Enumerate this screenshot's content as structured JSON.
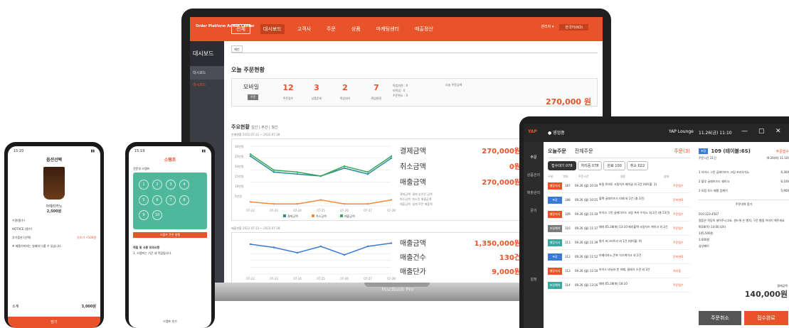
{
  "laptop": {
    "brand": "MacBook Pro",
    "logo": "Order Platform\nAdmin Center",
    "nav": [
      "전체",
      "대시보드",
      "고객사",
      "주문",
      "상품",
      "마케팅센터",
      "매출정산"
    ],
    "user": "관리자 ▾",
    "lang": "한국어(KO)",
    "side": {
      "title": "대시보드",
      "items": [
        "대시보드"
      ],
      "sub": "대시보드"
    },
    "tab": "메인",
    "today": {
      "title": "오늘 주문현황",
      "name": "모바일",
      "badge": "주문",
      "kpis": [
        {
          "v": "12",
          "l": "주문접수"
        },
        {
          "v": "3",
          "l": "상품준비"
        },
        {
          "v": "2",
          "l": "픽업대기"
        },
        {
          "v": "7",
          "l": "픽업완료"
        }
      ],
      "mini": [
        "픽업지연 : 0",
        "미픽업 : 0",
        "주문취소 : 0"
      ],
      "total_label": "오늘 주문금액",
      "total": "270,000 원"
    },
    "trend": {
      "title": "주요현황",
      "periods": "일간 | 주간 | 월간",
      "sub1": "판매현황 2022-07-22 ~ 2022-07-28",
      "rows": [
        {
          "l": "결제금액",
          "v": "270,000원"
        },
        {
          "l": "취소금액",
          "v": "0원"
        },
        {
          "l": "매출금액",
          "v": "270,000원"
        }
      ],
      "notes": [
        "결제금액: 결제 승인된 금액",
        "취소금액: 취소된 매출금액",
        "매출금액: 실제 주문 매출액"
      ],
      "legend": [
        "결제금액",
        "취소금액",
        "매출금액"
      ],
      "sub2": "매출현황 2022-07-22 ~ 2022-07-28",
      "rows2": [
        {
          "l": "매출금액",
          "v": "1,350,000원"
        },
        {
          "l": "매출건수",
          "v": "130건"
        },
        {
          "l": "매출단가",
          "v": "9,000원"
        }
      ]
    }
  },
  "chart_data": [
    {
      "type": "line",
      "title": "판매현황",
      "categories": [
        "07-22",
        "07-23",
        "07-24",
        "07-25",
        "07-26",
        "07-27",
        "07-28"
      ],
      "ylabels": [
        "5만원",
        "10만원",
        "15만원",
        "20만원",
        "25만원",
        "30만원"
      ],
      "series": [
        {
          "name": "결제금액",
          "values": [
            25,
            17,
            16,
            15,
            19,
            16,
            24
          ]
        },
        {
          "name": "취소금액",
          "values": [
            2,
            1,
            1,
            3,
            1,
            1,
            3
          ]
        },
        {
          "name": "매출금액",
          "values": [
            26,
            18,
            17,
            15,
            20,
            17,
            25
          ]
        }
      ],
      "colors": [
        "#2a8a96",
        "#f28a3c",
        "#3aa85a"
      ]
    },
    {
      "type": "line",
      "title": "매출현황",
      "categories": [
        "07-22",
        "07-23",
        "07-24",
        "07-25",
        "07-26",
        "07-27",
        "07-28"
      ],
      "series": [
        {
          "values": [
            28,
            25,
            20,
            26,
            18,
            26,
            29
          ]
        }
      ],
      "color": "#3a7ad6"
    }
  ],
  "tablet": {
    "title": "YAP Lounge",
    "time": "11.26(금) 11:10",
    "status": "● 영업중",
    "side": [
      "주문",
      "상품관리",
      "매출관리",
      "문의",
      "설정"
    ],
    "tabs": [
      "오늘주문",
      "전체주문"
    ],
    "alert": "주문(3)",
    "pills": [
      "접수대기 078",
      "처리중 078",
      "완료 100",
      "취소 022"
    ],
    "cols": [
      "구분",
      "번호",
      "주문시간",
      "내용",
      "상태"
    ],
    "rows": [
      {
        "tag": "매장식사",
        "c": "#e8532a",
        "n": "187",
        "t": "09.26 (월) 10:10",
        "d": "바질 토마토 크림치즈 베이글 외 2건 (테이블: 3)",
        "s": "주문접수"
      },
      {
        "tag": "포장",
        "c": "#3a7ad6",
        "n": "188",
        "t": "09.26 (월) 10:15",
        "d": "블랙 글레이즈드 라떼 외 2건 (총 3건)",
        "s": "준비완료"
      },
      {
        "tag": "매장식사",
        "c": "#e8532a",
        "n": "109",
        "t": "09.26 (월) 11:10",
        "d": "아이스 그린 글레이즈드 크림 프라 우치노 외 2건 (총 23건)",
        "s": "주문접수"
      },
      {
        "tag": "포장예약",
        "c": "#7a7a7a",
        "n": "110",
        "t": "09.26 (월) 11:37",
        "d": "예약:05.28(화) 13:10 메리블랙 크림치즈 케이크 외 2건",
        "s": "주문접수"
      },
      {
        "tag": "매장식사",
        "c": "#3aa8a0",
        "n": "111",
        "t": "09.26 (월) 11:39",
        "d": "딸기 바그티트리 외 1건 (테이블: 9)",
        "s": "주문접수"
      },
      {
        "tag": "포장",
        "c": "#3a7ad6",
        "n": "112",
        "t": "09.26 (월) 11:52",
        "d": "아메리카노,콘프 치즈케이크 외 2건",
        "s": "준비완료"
      },
      {
        "tag": "매장식사",
        "c": "#e8532a",
        "n": "113",
        "t": "09.26 (월) 12:10",
        "d": "아이스 바닐라 빈 라떼, 클래식 스콘 외 3건",
        "s": "처리중"
      },
      {
        "tag": "포장예약",
        "c": "#3aa8a0",
        "n": "114",
        "t": "09.26 (월) 13:16",
        "d": "예약:05.28(화) 18:10",
        "s": "주문접수"
      }
    ],
    "detail": {
      "badge": "포장",
      "num": "109 (테이블:6S)",
      "state": "주문접수",
      "time": "주문시간 21건",
      "stamp": "(9.26(화) 11:10)",
      "items": [
        {
          "n": "1 아이스 그린 글레이즈드 크림 프라우치노",
          "p": "6,300"
        },
        {
          "n": "2 블루 글레이즈드 쉐이크",
          "p": "6,100"
        },
        {
          "n": "3 모킹 토드 배럴 캅케이",
          "p": "5,900"
        }
      ],
      "addr_label": "주문내역 접기",
      "phone": "010-123-4567",
      "req": "얼음은 적당히 넣어주시고요, 샌드위 은 빵지, 구운 빵을 이야기 해주세요",
      "pick": "9/28(목) 14:00 (2h)",
      "amt": "145,500원",
      "disc": "3,000원",
      "pay": "삼성페이",
      "total_label": "결제금액",
      "total": "140,000원",
      "cancel": "주문취소",
      "done": "접수완료"
    }
  },
  "phone1": {
    "time": "15:20",
    "title": "옵션선택",
    "prod": "아메리카노",
    "price": "2,500원",
    "rows": [
      "수량(필수)",
      "HOT/ICE (필수)",
      "추가옵션 (선택)"
    ],
    "opt": "샷추가 +500원",
    "note": "※ 제품이미지는 실제와 다를 수 있습니다.",
    "sum_label": "소계",
    "sum": "3,000원",
    "btn": "담기"
  },
  "phone2": {
    "time": "15:19",
    "title": "스탬프",
    "sec": "전문부 스탬프",
    "rows": [
      "적립 및 사용 유의사항",
      "1. 스탬프는 기간 내 적립됩니다."
    ],
    "btn": "스탬프 쿠폰 발행",
    "foot": "스탬프 추가"
  }
}
